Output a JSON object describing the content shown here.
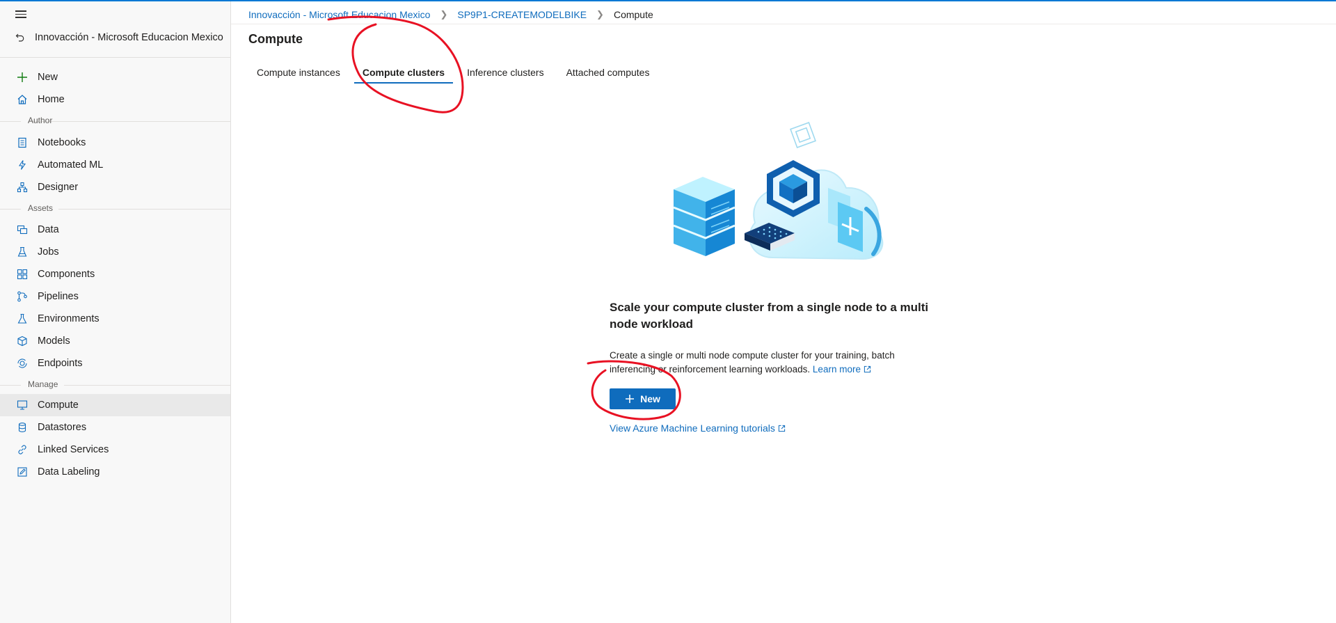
{
  "colors": {
    "accent": "#0f6cbd",
    "annotation": "#e81123"
  },
  "sidebar": {
    "workspace_name": "Innovacción - Microsoft Educacion Mexico",
    "items": [
      {
        "label": "New",
        "icon": "plus-icon"
      },
      {
        "label": "Home",
        "icon": "home-icon"
      }
    ],
    "sections": [
      {
        "label": "Author",
        "items": [
          {
            "label": "Notebooks",
            "icon": "notebook-icon"
          },
          {
            "label": "Automated ML",
            "icon": "automl-icon"
          },
          {
            "label": "Designer",
            "icon": "designer-icon"
          }
        ]
      },
      {
        "label": "Assets",
        "items": [
          {
            "label": "Data",
            "icon": "data-icon"
          },
          {
            "label": "Jobs",
            "icon": "flask-icon"
          },
          {
            "label": "Components",
            "icon": "components-icon"
          },
          {
            "label": "Pipelines",
            "icon": "pipeline-icon"
          },
          {
            "label": "Environments",
            "icon": "environment-icon"
          },
          {
            "label": "Models",
            "icon": "cube-icon"
          },
          {
            "label": "Endpoints",
            "icon": "endpoint-icon"
          }
        ]
      },
      {
        "label": "Manage",
        "items": [
          {
            "label": "Compute",
            "icon": "monitor-icon",
            "selected": true
          },
          {
            "label": "Datastores",
            "icon": "database-icon"
          },
          {
            "label": "Linked Services",
            "icon": "link-icon"
          },
          {
            "label": "Data Labeling",
            "icon": "edit-icon"
          }
        ]
      }
    ]
  },
  "breadcrumb": [
    {
      "label": "Innovacción - Microsoft Educacion Mexico",
      "link": true
    },
    {
      "label": "SP9P1-CREATEMODELBIKE",
      "link": true
    },
    {
      "label": "Compute",
      "link": false
    }
  ],
  "page_title": "Compute",
  "tabs": [
    {
      "label": "Compute instances",
      "active": false
    },
    {
      "label": "Compute clusters",
      "active": true
    },
    {
      "label": "Inference clusters",
      "active": false
    },
    {
      "label": "Attached computes",
      "active": false
    }
  ],
  "empty_state": {
    "title": "Scale your compute cluster from a single node to a multi node workload",
    "description": "Create a single or multi node compute cluster for your training, batch inferencing or reinforcement learning workloads.",
    "learn_more": "Learn more",
    "new_button": "New",
    "tutorial_link": "View Azure Machine Learning tutorials"
  }
}
